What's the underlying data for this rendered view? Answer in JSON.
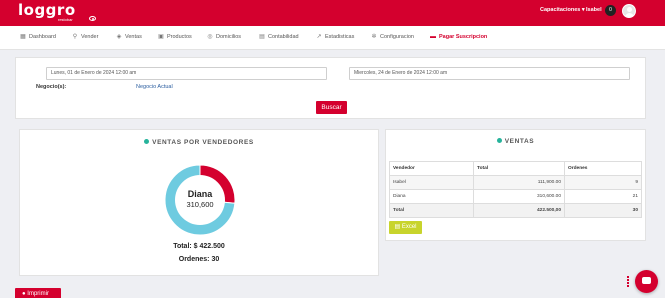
{
  "topbar": {
    "logo_text": "loggro",
    "logo_sub": "restobar",
    "menu_label": "Capacitaciones",
    "user_name": "Isabel",
    "notification_count": "0",
    "bg_color": "#d4002e"
  },
  "nav": {
    "items": [
      {
        "label": "Dashboard",
        "icon": "dashboard-icon"
      },
      {
        "label": "Vender",
        "icon": "vender-icon"
      },
      {
        "label": "Ventas",
        "icon": "tag-icon"
      },
      {
        "label": "Productos",
        "icon": "box-icon"
      },
      {
        "label": "Domicilios",
        "icon": "motorbike-icon"
      },
      {
        "label": "Contabilidad",
        "icon": "document-icon"
      },
      {
        "label": "Estadisticas",
        "icon": "chart-line-icon"
      },
      {
        "label": "Configuracion",
        "icon": "gear-icon"
      },
      {
        "label": "Pagar Suscripcion",
        "icon": "card-icon"
      }
    ],
    "active_index": 8
  },
  "filter": {
    "date_from": "Lunes, 01 de Enero de 2024 12:00 am",
    "date_to": "Miercoles, 24 de Enero de 2024 12:00 am",
    "business_label": "Negocio(s):",
    "business_value": "Negocio Actual",
    "search_button": "Buscar"
  },
  "sales_by_seller": {
    "title": "VENTAS POR VENDEDORES",
    "center_name": "Diana",
    "center_value": "310,600",
    "total_text": "Total: $ 422.500",
    "orders_text": "Ordenes: 30"
  },
  "chart_data": {
    "type": "pie",
    "categories": [
      "Isabel",
      "Diana"
    ],
    "values": [
      111900,
      310600
    ],
    "colors": [
      "#d4002e",
      "#6ecbe0"
    ]
  },
  "sales_table": {
    "title": "VENTAS",
    "columns": [
      "Vendedor",
      "Total",
      "Ordenes"
    ],
    "rows": [
      {
        "seller": "Isabel",
        "total": "111,900.00",
        "orders": "9"
      },
      {
        "seller": "Diana",
        "total": "310,600.00",
        "orders": "21"
      }
    ],
    "total_row": {
      "label": "Total",
      "total": "422.500,00",
      "orders": "30"
    },
    "excel_button": "Excel"
  },
  "footer": {
    "print_button": "Imprimir"
  }
}
